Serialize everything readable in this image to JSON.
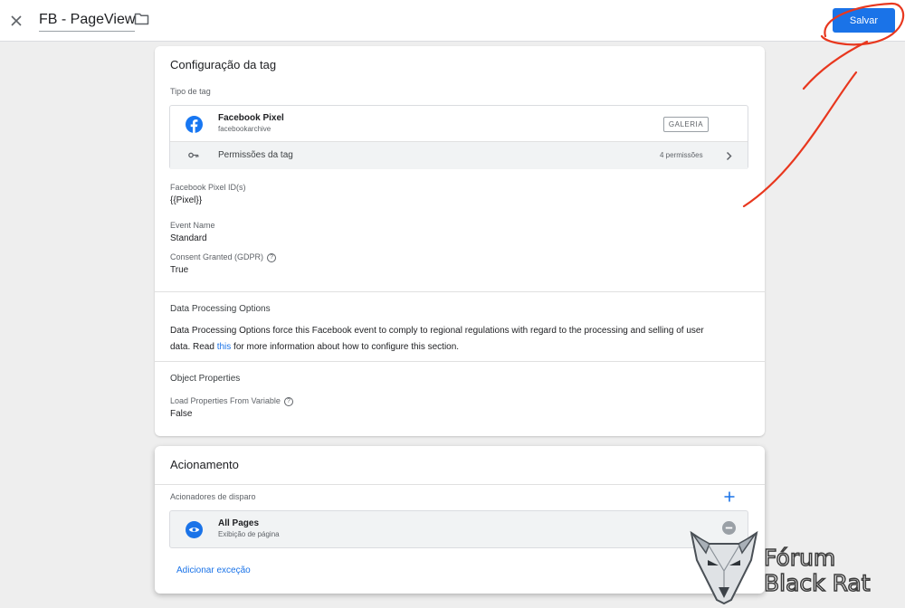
{
  "header": {
    "title": "FB - PageView",
    "close_icon": "close-icon",
    "folder_icon": "folder-icon",
    "save_label": "Salvar"
  },
  "tag_config": {
    "title": "Configuração da tag",
    "type_label": "Tipo de tag",
    "tag_type": {
      "name": "Facebook Pixel",
      "vendor": "facebookarchive",
      "icon": "facebook-icon",
      "gallery_badge": "GALERIA"
    },
    "permissions": {
      "label": "Permissões da tag",
      "count": "4 permissões",
      "icon": "key-icon"
    },
    "fields": {
      "pixel_id_label": "Facebook Pixel ID(s)",
      "pixel_id_value": "{{Pixel}}",
      "event_name_label": "Event Name",
      "event_name_value": "Standard",
      "consent_label": "Consent Granted (GDPR)",
      "consent_value": "True"
    },
    "dpo": {
      "title": "Data Processing Options",
      "text_line1": "Data Processing Options force this Facebook event to comply to regional regulations with regard to the processing and selling of user",
      "text_line2_pre": "data. Read ",
      "link": "this",
      "text_line2_post": " for more information about how to configure this section."
    },
    "object_props": {
      "title": "Object Properties",
      "load_label": "Load Properties From Variable",
      "load_value": "False"
    }
  },
  "triggering": {
    "title": "Acionamento",
    "triggers_label": "Acionadores de disparo",
    "trigger": {
      "name": "All Pages",
      "type": "Exibição de página",
      "icon": "eye-icon"
    },
    "add_exception": "Adicionar exceção"
  },
  "watermark": {
    "line1": "Fórum",
    "line2": "Black Rat"
  },
  "colors": {
    "accent": "#1a73e8",
    "facebook": "#1877f2",
    "annotation": "#e8371e"
  }
}
